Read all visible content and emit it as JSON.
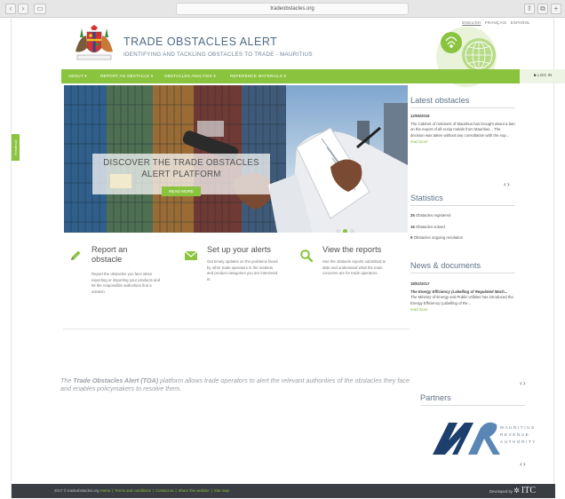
{
  "browser": {
    "url": "tradeobstacles.org"
  },
  "languages": {
    "english": "ENGLISH",
    "french": "FRANÇAIS",
    "spanish": "ESPAÑOL"
  },
  "header": {
    "title": "TRADE OBSTACLES ALERT",
    "subtitle": "IDENTIFYING AND TACKLING OBSTACLES TO TRADE - MAURITIUS"
  },
  "nav": {
    "items": [
      {
        "label": "ABOUT ▾"
      },
      {
        "label": "REPORT AN OBSTACLE ▾"
      },
      {
        "label": "OBSTACLES ANALYSIS ▾"
      },
      {
        "label": "REFERENCE MATERIALS ▾"
      }
    ],
    "login": "LOG IN"
  },
  "feedback": {
    "label": "Feedback"
  },
  "hero": {
    "title": "DISCOVER THE TRADE OBSTACLES ALERT PLATFORM",
    "read_more": "READ MORE"
  },
  "features": [
    {
      "title": "Report an obstacle",
      "text": "Report the obstacles you face when exporting or importing your products and let the responsible authorities find a solution."
    },
    {
      "title": "Set up your alerts",
      "text": "Get timely updates on the problems faced by other trade operators in the markets and product categories you are interested in."
    },
    {
      "title": "View the reports",
      "text": "See the obstacle reports submitted to date and understand what the main concerns are for trade operators."
    }
  ],
  "tagline": {
    "brand": "Trade Obstacles Alert (TOA)",
    "before": "The ",
    "after": " platform allows trade operators to alert the relevant authorities of the obstacles they face and enables policymakers to resolve them."
  },
  "latest": {
    "heading": "Latest obstacles",
    "date": "12/06/2016",
    "text": "The Cabinet of ministers of Mauritius has brought about a ban on the export of all scrap metals from Mauritius... The decision was taken without any consultation with the exp...",
    "more": "read more",
    "arrows": "‹›"
  },
  "statistics": {
    "heading": "Statistics",
    "items": [
      {
        "count": "25",
        "label": "Obstacles registered"
      },
      {
        "count": "16",
        "label": "Obstacles solved"
      },
      {
        "count": "9",
        "label": "Obstacles ongoing resolution"
      }
    ]
  },
  "news": {
    "heading": "News & documents",
    "date": "18/02/2017",
    "title": "The Energy Efficiency (Labelling of Regulated Mach...",
    "text": "The Ministry of Energy and Public Utilities has introduced the Energy Efficiency (Labelling of Re...",
    "more": "read more",
    "arrows": "‹›"
  },
  "partners": {
    "heading": "Partners",
    "logo_text": [
      "MAURITIUS",
      "REVENUE",
      "AUTHORITY"
    ],
    "arrows": "‹›"
  },
  "footer": {
    "copyright": "2017 © tradeobstacles.org",
    "links": [
      "Home",
      "Terms and conditions",
      "Contact us",
      "Share this website",
      "Site map"
    ],
    "developed_by": "Developed by",
    "itc": "ITC"
  },
  "colors": {
    "accent": "#8ac43f",
    "title_blue": "#4e6a84",
    "footer_bg": "#3a3d42"
  }
}
